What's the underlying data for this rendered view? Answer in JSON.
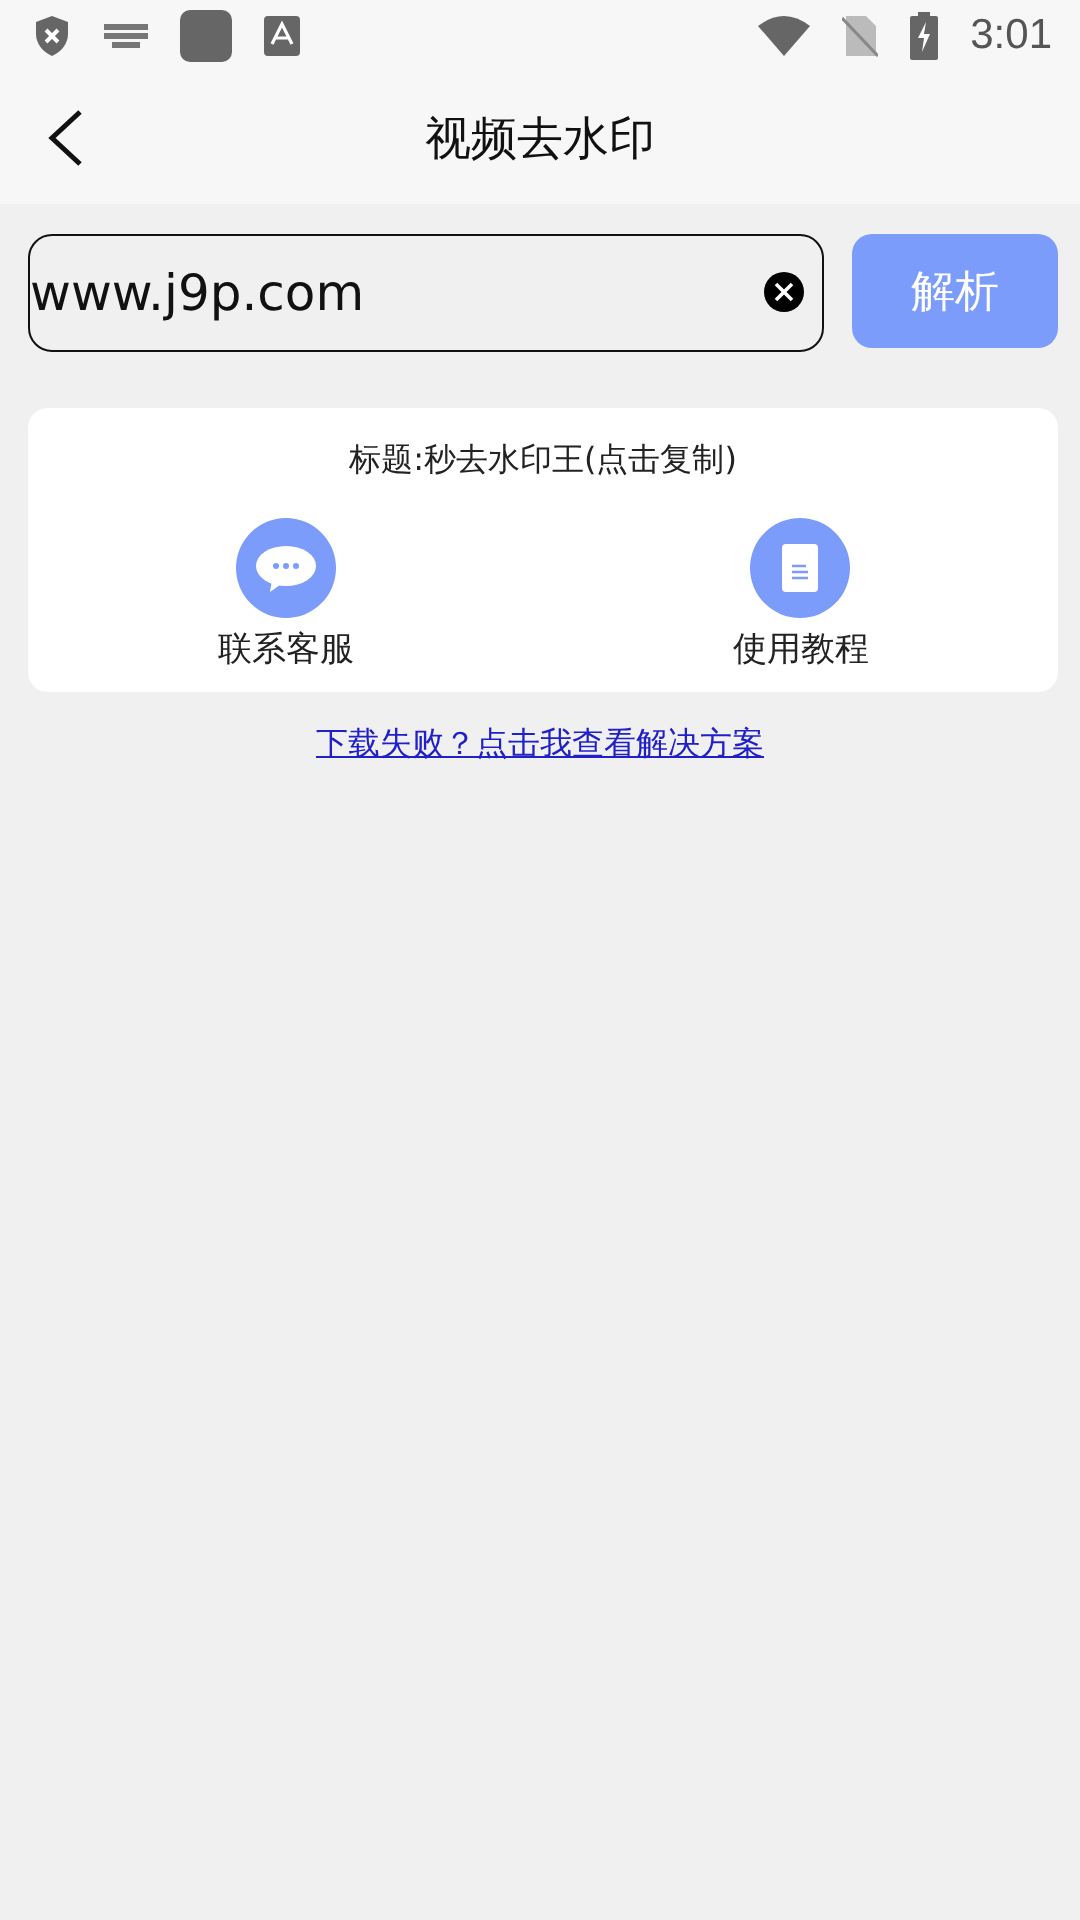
{
  "status_bar": {
    "time": "3:01"
  },
  "app_bar": {
    "title": "视频去水印"
  },
  "url_field": {
    "value": "www.j9p.com"
  },
  "parse_button": {
    "label": "解析"
  },
  "result_card": {
    "title": "标题:秒去水印王(点击复制)",
    "actions": [
      {
        "kind": "chat",
        "label": "联系客服"
      },
      {
        "kind": "doc",
        "label": "使用教程"
      }
    ]
  },
  "help_link": "下载失败？点击我查看解决方案"
}
